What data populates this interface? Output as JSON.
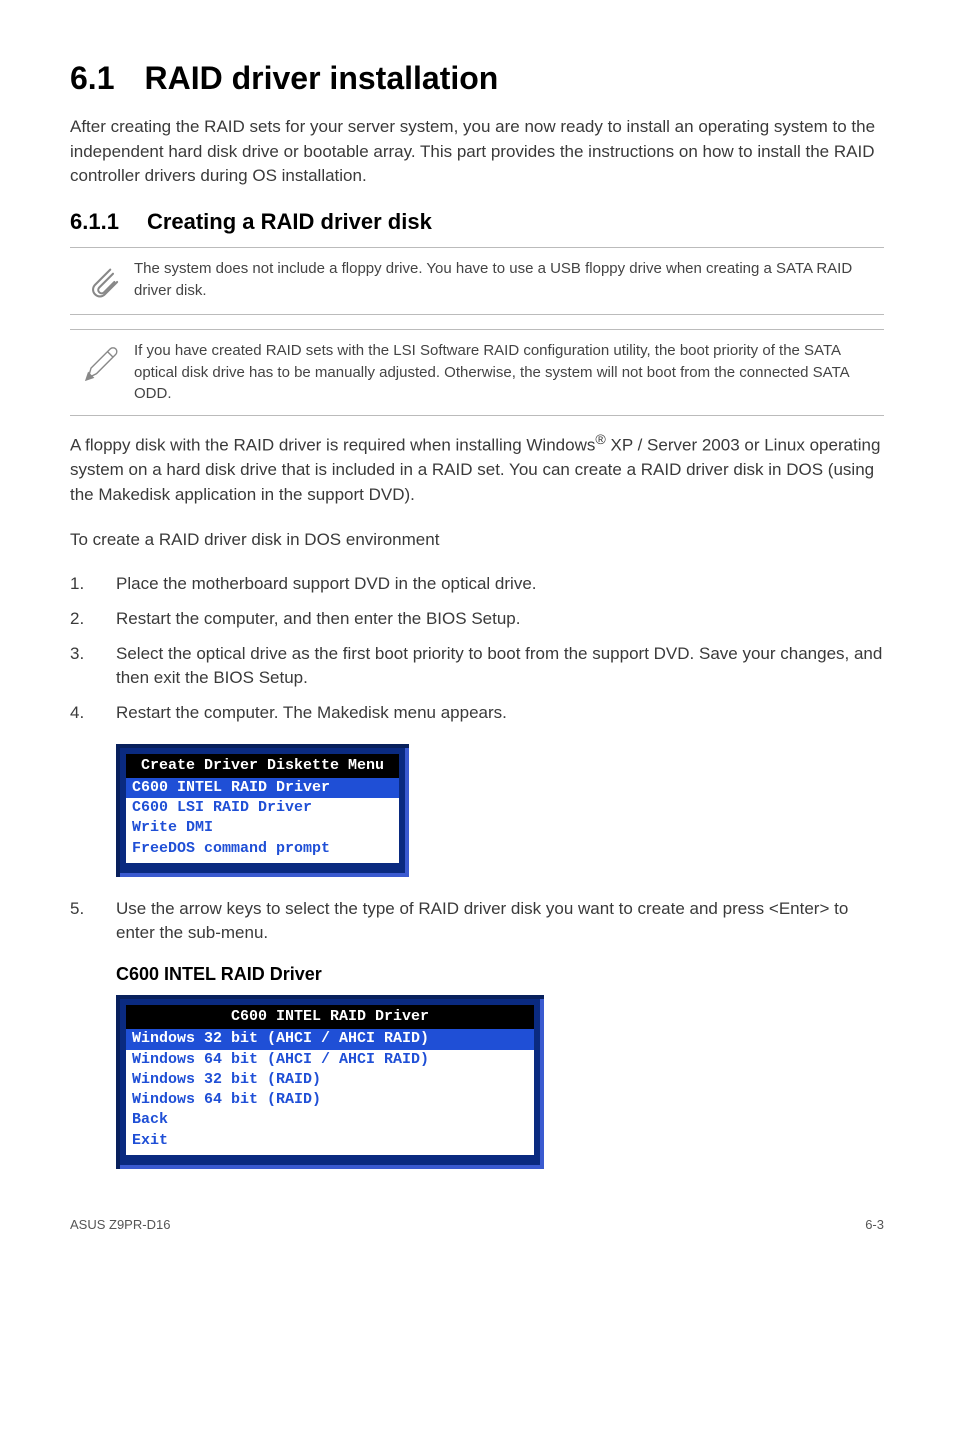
{
  "section": {
    "number": "6.1",
    "title": "RAID driver installation",
    "intro": "After creating the RAID sets for your server system, you are now ready to install an operating system to the independent hard disk drive or bootable array. This part provides the instructions on how to install the RAID controller drivers during OS installation."
  },
  "subsection": {
    "number": "6.1.1",
    "title": "Creating a RAID driver disk"
  },
  "note1": "The system does not include a floppy drive. You have to use a USB floppy drive when creating a SATA RAID driver disk.",
  "note2": "If you have created RAID sets with the LSI Software RAID configuration utility, the boot priority of the SATA optical disk drive has to be manually adjusted. Otherwise, the system will not boot from the connected SATA ODD.",
  "para_floppy_pre": "A floppy disk with the RAID driver is required when installing Windows",
  "para_floppy_sup": "®",
  "para_floppy_post": " XP / Server 2003 or Linux operating system on a hard disk drive that is included in a RAID set. You can create a RAID driver disk in DOS (using the Makedisk application in the support DVD).",
  "para_dos": "To create a RAID driver disk in DOS environment",
  "steps": [
    {
      "n": "1.",
      "t": "Place the motherboard support DVD in the optical drive."
    },
    {
      "n": "2.",
      "t": "Restart the computer, and then enter the BIOS Setup."
    },
    {
      "n": "3.",
      "t": "Select the optical drive as the first boot priority to boot from the support DVD. Save your changes, and then exit the BIOS Setup."
    },
    {
      "n": "4.",
      "t": "Restart the computer. The Makedisk menu appears."
    }
  ],
  "menu1": {
    "title": " Create Driver Diskette Menu ",
    "selected": "C600 INTEL RAID Driver       ",
    "line1": "C600 LSI RAID Driver         ",
    "line2": "Write DMI                    ",
    "line3": "FreeDOS command prompt       "
  },
  "step5": {
    "n": "5.",
    "t": "Use the arrow keys to select the type of RAID driver disk you want to create and press <Enter> to enter the sub-menu."
  },
  "mini_title": "C600 INTEL RAID Driver",
  "menu2": {
    "title": "           C600 INTEL RAID Driver           ",
    "selected": "Windows 32 bit (AHCI / AHCI RAID)           ",
    "line1": "Windows 64 bit (AHCI / AHCI RAID)           ",
    "line2": "Windows 32 bit (RAID)                       ",
    "line3": "Windows 64 bit (RAID)                       ",
    "line4": "Back                                        ",
    "line5": "Exit                                        "
  },
  "footer_left": "ASUS Z9PR-D16",
  "footer_right": "6-3"
}
